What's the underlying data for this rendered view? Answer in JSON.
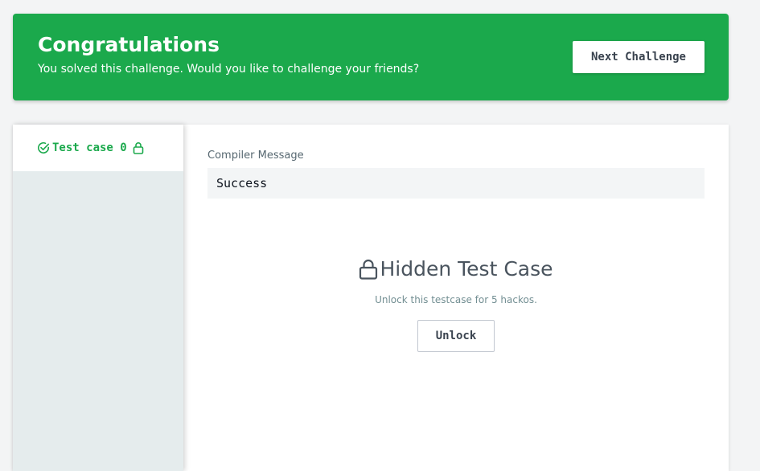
{
  "banner": {
    "title": "Congratulations",
    "subtitle": "You solved this challenge. Would you like to challenge your friends?",
    "next_button_label": "Next Challenge",
    "color": "#1ba94c"
  },
  "tabs": [
    {
      "label": "Test case 0",
      "status_icon": "check-circle-icon",
      "lock_icon": "lock-icon",
      "active": true,
      "color": "#1ba94c"
    }
  ],
  "compiler": {
    "label": "Compiler Message",
    "value": "Success"
  },
  "hidden_case": {
    "icon": "lock-icon",
    "title": "Hidden Test Case",
    "description": "Unlock this testcase for 5 hackos.",
    "button_label": "Unlock"
  }
}
